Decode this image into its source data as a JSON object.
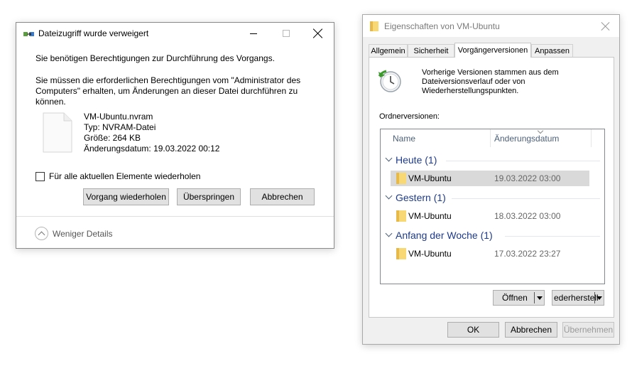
{
  "access_dialog": {
    "title": "Dateizugriff wurde verweigert",
    "message1": "Sie benötigen Berechtigungen zur Durchführung des Vorgangs.",
    "message2": "Sie müssen die erforderlichen Berechtigungen vom \"Administrator des Computers\" erhalten, um Änderungen an dieser Datei durchführen zu können.",
    "file": {
      "name": "VM-Ubuntu.nvram",
      "type": "Typ: NVRAM-Datei",
      "size": "Größe: 264 KB",
      "modified": "Änderungsdatum: 19.03.2022 00:12"
    },
    "repeat_checkbox_label": "Für alle aktuellen Elemente wiederholen",
    "buttons": {
      "retry": "Vorgang wiederholen",
      "skip": "Überspringen",
      "cancel": "Abbrechen"
    },
    "less_details": "Weniger Details"
  },
  "properties_dialog": {
    "title": "Eigenschaften von VM-Ubuntu",
    "tabs": [
      "Allgemein",
      "Sicherheit",
      "Vorgängerversionen",
      "Anpassen"
    ],
    "active_tab": "Vorgängerversionen",
    "description": "Vorherige Versionen stammen aus dem Dateiversionsverlauf oder von Wiederherstellungspunkten.",
    "folder_versions_label": "Ordnerversionen:",
    "columns": [
      "Name",
      "Änderungsdatum"
    ],
    "groups": [
      {
        "title": "Heute (1)",
        "items": [
          {
            "name": "VM-Ubuntu",
            "date": "19.03.2022 03:00",
            "selected": true
          }
        ]
      },
      {
        "title": "Gestern (1)",
        "items": [
          {
            "name": "VM-Ubuntu",
            "date": "18.03.2022 03:00",
            "selected": false
          }
        ]
      },
      {
        "title": "Anfang der Woche (1)",
        "items": [
          {
            "name": "VM-Ubuntu",
            "date": "17.03.2022 23:27",
            "selected": false
          }
        ]
      }
    ],
    "open_button": "Öffnen",
    "restore_button": "ederherstell",
    "ok_button": "OK",
    "cancel_button": "Abbrechen",
    "apply_button": "Übernehmen"
  },
  "colors": {
    "group_title": "#1e3a8a",
    "folder_yellow": "#f8d775",
    "selected_row": "#d9d9d9"
  }
}
